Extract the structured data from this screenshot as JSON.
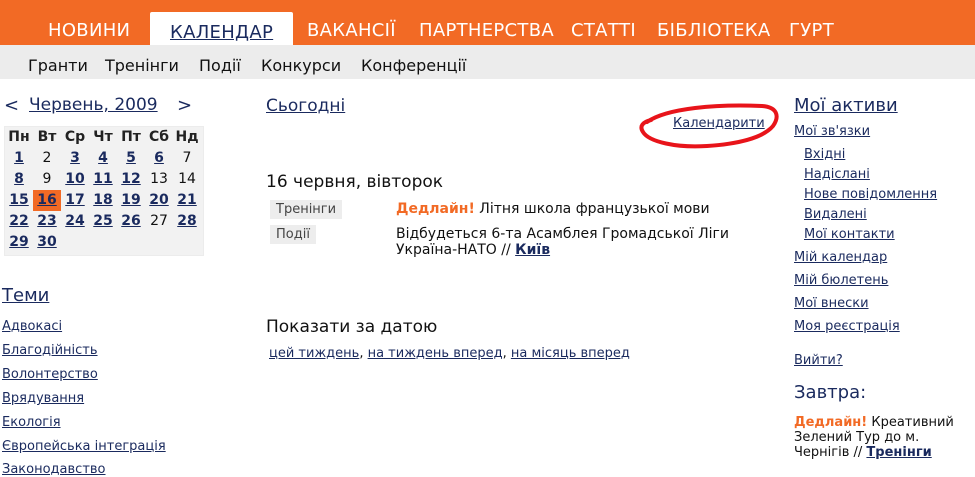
{
  "topnav": {
    "tabs": [
      "НОВИНИ",
      "КАЛЕНДАР",
      "ВАКАНСІЇ",
      "ПАРТНЕРСТВА",
      "СТАТТІ",
      "БІБЛІОТЕКА",
      "ГУРТ"
    ],
    "active": "КАЛЕНДАР"
  },
  "subnav": {
    "items": [
      "Гранти",
      "Тренінги",
      "Події",
      "Конкурси",
      "Конференції"
    ]
  },
  "calendar": {
    "prev": "<",
    "next": ">",
    "month": "Червень, 2009",
    "weekdays": [
      "Пн",
      "Вт",
      "Ср",
      "Чт",
      "Пт",
      "Сб",
      "Нд"
    ],
    "weeks": [
      [
        "1",
        "2",
        "3",
        "4",
        "5",
        "6",
        "7"
      ],
      [
        "8",
        "9",
        "10",
        "11",
        "12",
        "13",
        "14"
      ],
      [
        "15",
        "16",
        "17",
        "18",
        "19",
        "20",
        "21"
      ],
      [
        "22",
        "23",
        "24",
        "25",
        "26",
        "27",
        "28"
      ],
      [
        "29",
        "30",
        "",
        "",
        "",
        "",
        ""
      ]
    ],
    "event_days": [
      "1",
      "3",
      "4",
      "5",
      "6",
      "8",
      "10",
      "11",
      "12",
      "15",
      "16",
      "17",
      "18",
      "19",
      "20",
      "21",
      "22",
      "23",
      "24",
      "25",
      "26",
      "28",
      "29",
      "30"
    ],
    "today": "16"
  },
  "themes": {
    "title": "Теми",
    "items": [
      "Адвокасі",
      "Благодійність",
      "Волонтерство",
      "Врядування",
      "Екологія",
      "Європейська інтеграція",
      "Законодавство"
    ]
  },
  "main": {
    "today_label": "Сьогодні",
    "calendars_label": "Календарити",
    "date_heading": "16 червня, вівторок",
    "events": [
      {
        "tag": "Тренінги",
        "deadline": "Дедлайн!",
        "text": "Літня школа французької мови",
        "city": ""
      },
      {
        "tag": "Події",
        "deadline": "",
        "text": "Відбудеться 6-та Асамблея Громадської Ліги Україна-НАТО //",
        "city": "Київ"
      }
    ],
    "show_by_date": "Показати за датою",
    "date_links": [
      "цей тиждень",
      "на тиждень вперед",
      "на місяць вперед"
    ]
  },
  "right": {
    "assets_title": "Мої активи",
    "links": [
      "Мої зв'язки",
      "Мій календар",
      "Мій бюлетень",
      "Мої внески",
      "Моя реєстрація",
      "Вийти?"
    ],
    "sublinks": [
      "Вхідні",
      "Надіслані",
      "Нове повідомлення",
      "Видалені",
      "Мої контакти"
    ],
    "tomorrow_title": "Завтра:",
    "tomorrow": {
      "deadline": "Дедлайн!",
      "text": "Креативний Зелений Тур до м. Чернігів //",
      "tag": "Тренінги"
    }
  },
  "colors": {
    "accent": "#f26a25",
    "link": "#1a2a5e",
    "highlight_circle": "#e8141a"
  }
}
